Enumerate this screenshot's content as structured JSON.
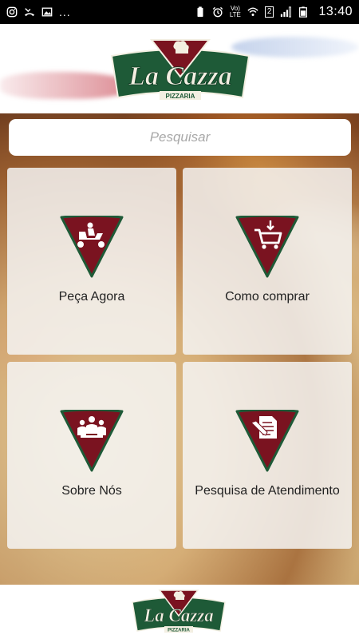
{
  "status_bar": {
    "time": "13:40",
    "overflow": "...",
    "network": "LTE",
    "volte": "Vo)",
    "sim_badge": "2",
    "left_icons": [
      "instagram-icon",
      "missed-call-icon",
      "image-icon"
    ],
    "right_icons": [
      "battery-saver-icon",
      "alarm-icon",
      "wifi-icon",
      "signal-icon",
      "battery-icon"
    ]
  },
  "brand": {
    "name": "La Cazza",
    "subtitle": "PIZZARIA",
    "colors": {
      "green": "#1e5a37",
      "red": "#7a1320",
      "cream": "#f3efe2"
    }
  },
  "search": {
    "placeholder": "Pesquisar"
  },
  "menu": [
    {
      "label": "Peça Agora",
      "icon": "delivery-scooter-icon"
    },
    {
      "label": "Como comprar",
      "icon": "shopping-cart-icon"
    },
    {
      "label": "Sobre Nós",
      "icon": "team-icon"
    },
    {
      "label": "Pesquisa de Atendimento",
      "icon": "survey-form-icon"
    }
  ]
}
